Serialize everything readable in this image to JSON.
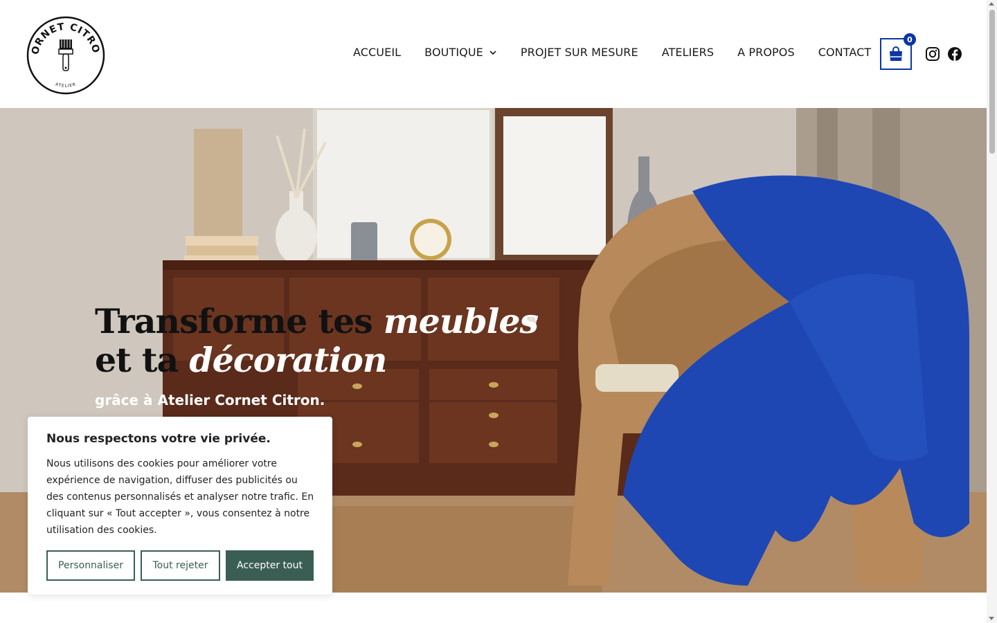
{
  "brand": {
    "logo_top_text": "CORNET CITRON",
    "logo_bottom_text": "ATELIER",
    "color": "#111111"
  },
  "nav": {
    "items": [
      {
        "label": "ACCUEIL"
      },
      {
        "label": "BOUTIQUE",
        "has_dropdown": true
      },
      {
        "label": "PROJET SUR MESURE"
      },
      {
        "label": "ATELIERS"
      },
      {
        "label": "A PROPOS"
      },
      {
        "label": "CONTACT"
      }
    ]
  },
  "cart": {
    "count": "0",
    "icon": "shopping-bag-icon",
    "accent": "#0a36a8"
  },
  "social": {
    "instagram_icon": "instagram-icon",
    "facebook_icon": "facebook-icon"
  },
  "hero": {
    "title_part1": "Transforme tes ",
    "title_italic1": "meubles",
    "title_part2": "et ta ",
    "title_italic2": "décoration",
    "subtitle": "grâce à Atelier Cornet Citron."
  },
  "cookie": {
    "title": "Nous respectons votre vie privée.",
    "body": "Nous utilisons des cookies pour améliorer votre expérience de navigation, diffuser des publicités ou des contenus personnalisés et analyser notre trafic. En cliquant sur « Tout accepter », vous consentez à notre utilisation des cookies.",
    "customize_label": "Personnaliser",
    "reject_label": "Tout rejeter",
    "accept_label": "Accepter tout",
    "accent": "#3b5e54"
  }
}
